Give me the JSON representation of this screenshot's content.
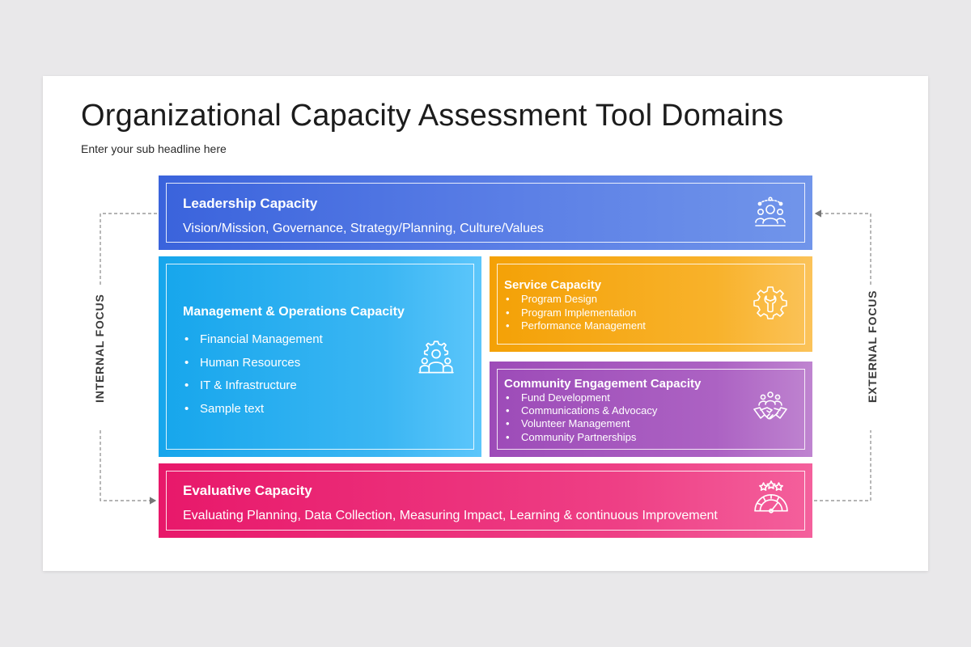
{
  "header": {
    "title": "Organizational Capacity Assessment Tool Domains",
    "subtitle": "Enter your sub headline here"
  },
  "side_labels": {
    "internal": "INTERNAL FOCUS",
    "external": "EXTERNAL FOCUS"
  },
  "blocks": {
    "leadership": {
      "title": "Leadership Capacity",
      "text": "Vision/Mission, Governance, Strategy/Planning, Culture/Values",
      "icon": "leadership-team-icon",
      "color": "#3a63dc"
    },
    "management": {
      "title": "Management & Operations Capacity",
      "items": [
        "Financial Management",
        "Human Resources",
        "IT & Infrastructure",
        "Sample text"
      ],
      "icon": "team-gear-icon",
      "color": "#16a6ec"
    },
    "service": {
      "title": "Service Capacity",
      "items": [
        "Program Design",
        "Program Implementation",
        "Performance Management"
      ],
      "icon": "gear-wrench-icon",
      "color": "#f4a106"
    },
    "community": {
      "title": "Community Engagement Capacity",
      "items": [
        "Fund Development",
        "Communications & Advocacy",
        "Volunteer Management",
        "Community Partnerships"
      ],
      "icon": "handshake-people-icon",
      "color": "#9d4bb8"
    },
    "evaluative": {
      "title": "Evaluative Capacity",
      "text": "Evaluating Planning, Data Collection, Measuring Impact, Learning & continuous Improvement",
      "icon": "rating-gauge-icon",
      "color": "#e8186a"
    }
  }
}
